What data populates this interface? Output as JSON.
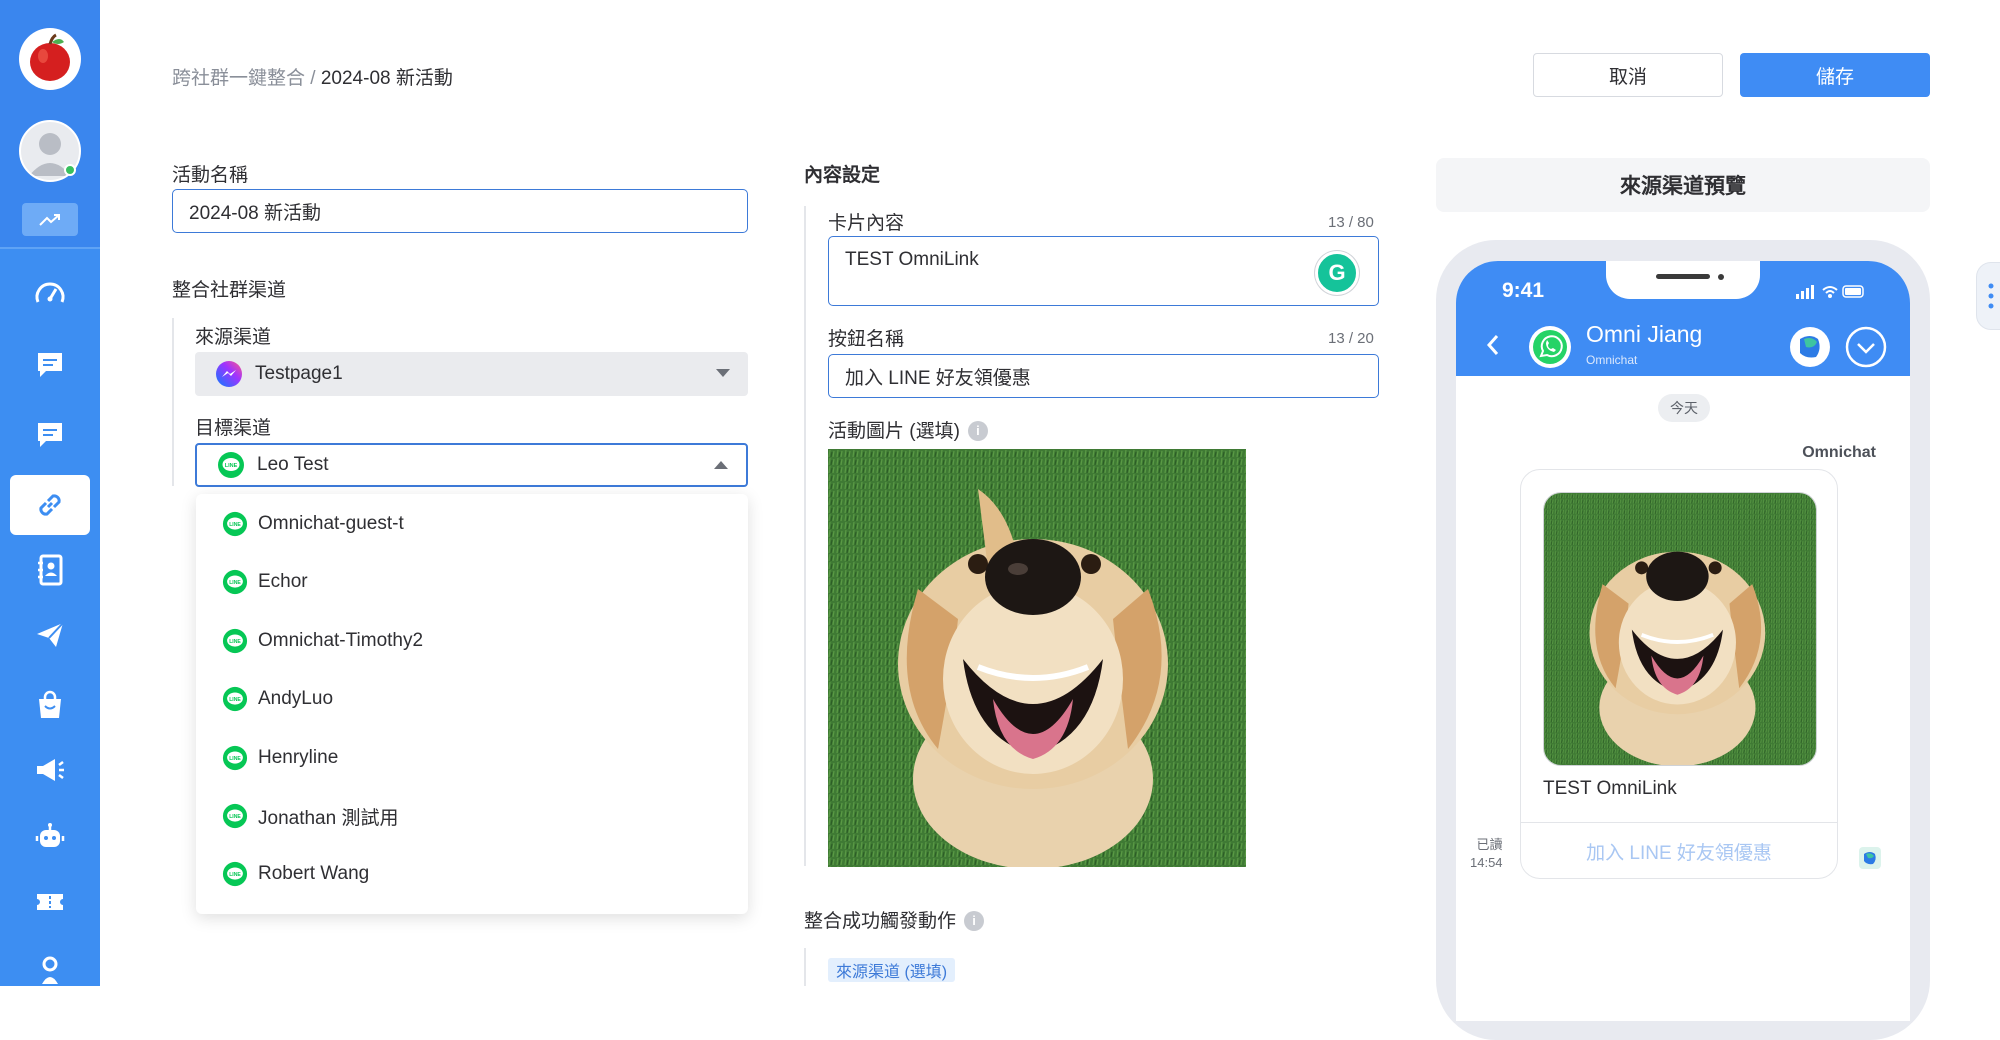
{
  "sidebar": {
    "items": [
      {
        "name": "dashboard",
        "active": false
      },
      {
        "name": "chat",
        "active": false
      },
      {
        "name": "chat-2",
        "active": false
      },
      {
        "name": "omnilink",
        "active": true
      },
      {
        "name": "contacts",
        "active": false
      },
      {
        "name": "broadcast",
        "active": false
      },
      {
        "name": "shop",
        "active": false
      },
      {
        "name": "campaign",
        "active": false
      },
      {
        "name": "bot",
        "active": false
      },
      {
        "name": "ticket",
        "active": false
      },
      {
        "name": "help",
        "active": false
      }
    ]
  },
  "header": {
    "breadcrumb_parent": "跨社群一鍵整合",
    "breadcrumb_sep": "/",
    "breadcrumb_current": "2024-08 新活動",
    "cancel_label": "取消",
    "save_label": "儲存"
  },
  "form": {
    "activity_name_label": "活動名稱",
    "activity_name_value": "2024-08 新活動",
    "channels_title": "整合社群渠道",
    "source_label": "來源渠道",
    "source_value": "Testpage1",
    "target_label": "目標渠道",
    "target_value": "Leo Test",
    "target_options": [
      "Omnichat-guest-t",
      "Echor",
      "Omnichat-Timothy2",
      "AndyLuo",
      "Henryline",
      "Jonathan 測試用",
      "Robert Wang"
    ]
  },
  "content": {
    "title": "內容設定",
    "card_label": "卡片內容",
    "card_counter": "13 / 80",
    "card_value": "TEST OmniLink",
    "button_label": "按鈕名稱",
    "button_counter": "13 / 20",
    "button_value": "加入 LINE 好友領優惠",
    "image_label": "活動圖片 (選填)",
    "info_glyph": "i",
    "trigger_title": "整合成功觸發動作",
    "source_tag": "來源渠道 (選填)"
  },
  "preview": {
    "title": "來源渠道預覽",
    "time": "9:41",
    "contact_name": "Omni Jiang",
    "contact_sub": "Omnichat",
    "date": "今天",
    "sender": "Omnichat",
    "card_text": "TEST OmniLink",
    "card_button": "加入 LINE 好友領優惠",
    "read_label": "已讀",
    "read_time": "14:54"
  },
  "colors": {
    "sidebar": "#3d8ef2",
    "primary": "#3f8cf4",
    "line_green": "#06c755",
    "whatsapp_green": "#25d366"
  }
}
